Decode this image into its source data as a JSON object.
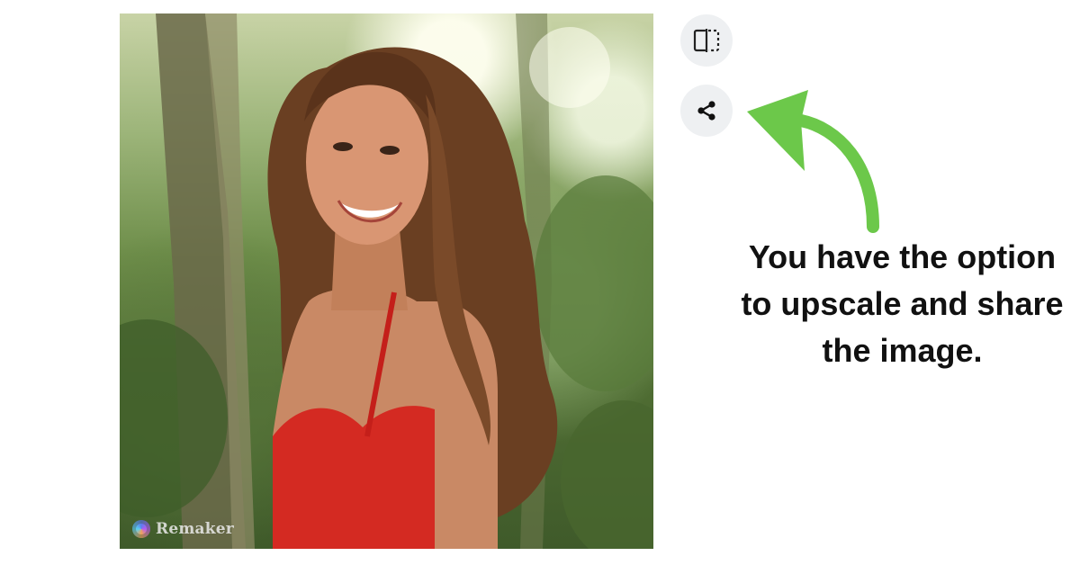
{
  "photo": {
    "watermark_text": "Remaker",
    "watermark_logo_icon": "remaker-logo-icon"
  },
  "actions": {
    "upscale_icon": "split-compare-icon",
    "share_icon": "share-icon"
  },
  "annotation": {
    "arrow_icon": "curved-arrow-icon",
    "arrow_color": "#6cc84a",
    "caption_lines": [
      "You have the option",
      "to upscale and share",
      "the image."
    ]
  }
}
